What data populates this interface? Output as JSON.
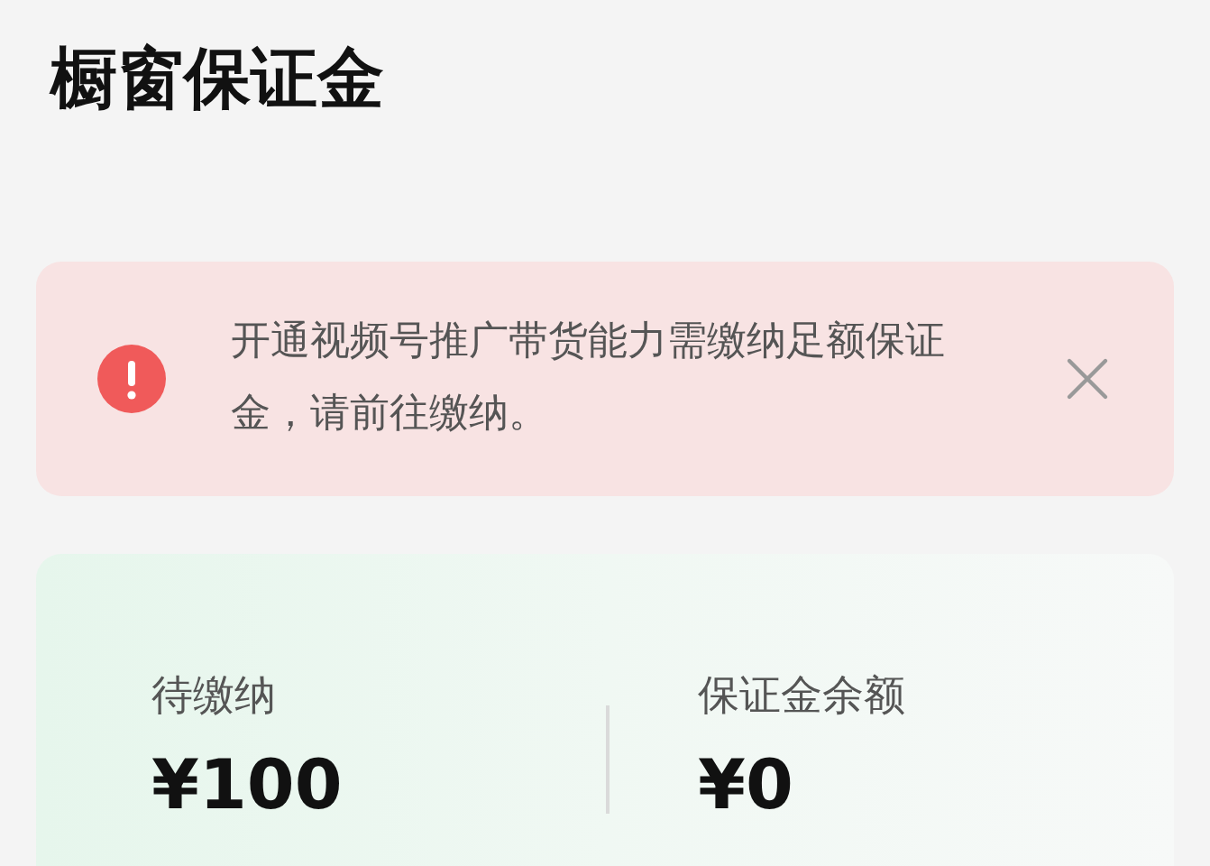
{
  "title": "橱窗保证金",
  "alert": {
    "message": "开通视频号推广带货能力需缴纳足额保证金，请前往缴纳。"
  },
  "stats": [
    {
      "label": "待缴纳",
      "value": "¥100"
    },
    {
      "label": "保证金余额",
      "value": "¥0"
    }
  ]
}
